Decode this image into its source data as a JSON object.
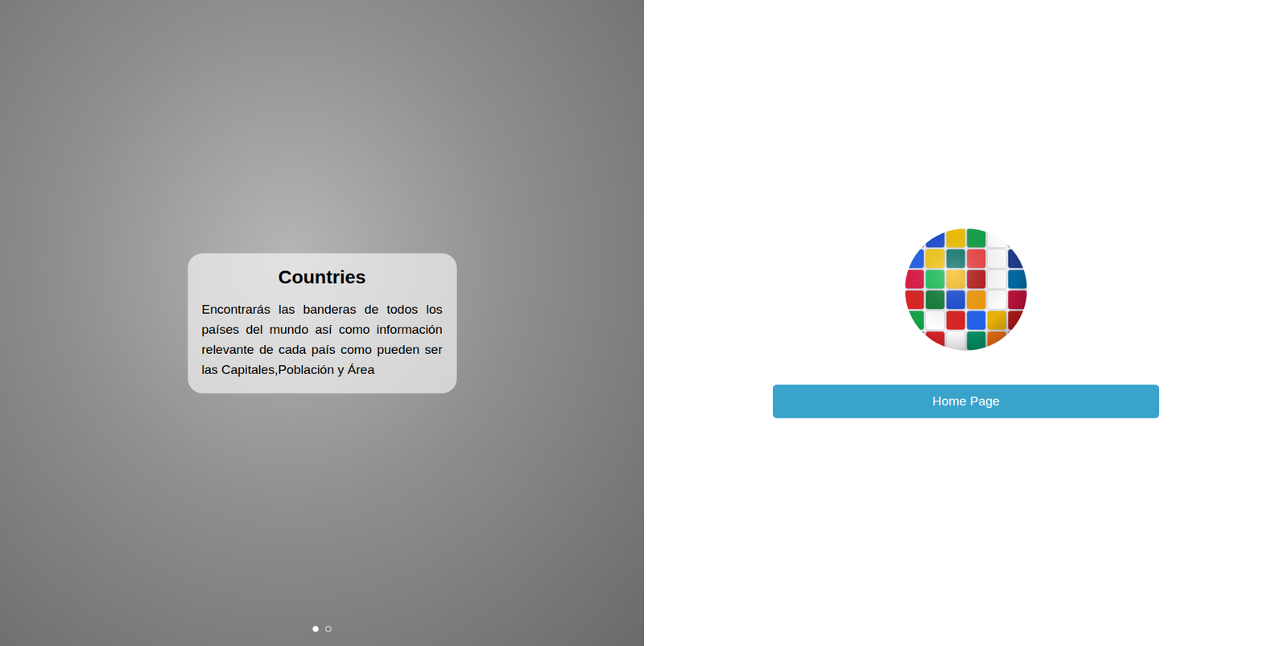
{
  "carousel": {
    "slides": [
      {
        "title": "Countries",
        "description": "Encontrarás las banderas de todos los países del mundo así como información relevante de cada país como pueden ser las Capitales,Población y Área"
      }
    ],
    "indicators": [
      {
        "selected": true
      },
      {
        "selected": false
      }
    ]
  },
  "home_button": {
    "label": "Home Page"
  }
}
